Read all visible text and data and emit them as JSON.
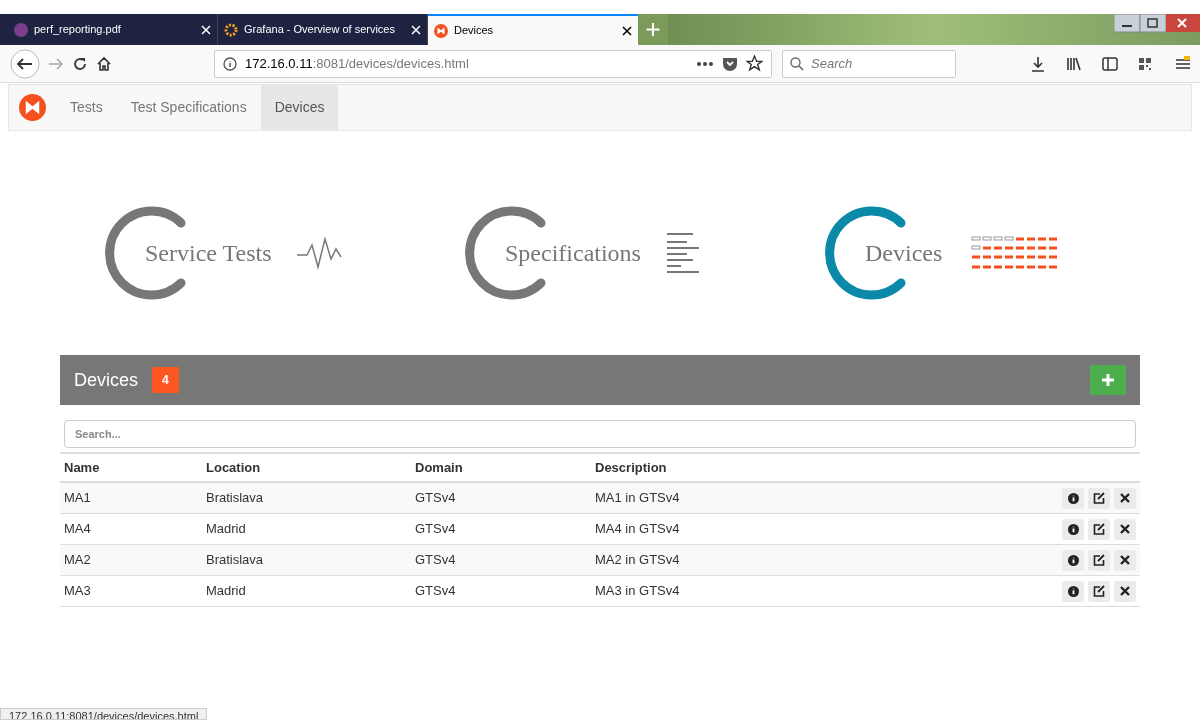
{
  "browser": {
    "tabs": [
      {
        "title": "perf_reporting.pdf",
        "kind": "pdf",
        "selected": false
      },
      {
        "title": "Grafana - Overview of services",
        "kind": "grafana",
        "selected": false
      },
      {
        "title": "Devices",
        "kind": "app",
        "selected": true
      }
    ],
    "url_host": "172.16.0.11",
    "url_rest": ":8081/devices/devices.html",
    "search": {
      "placeholder": "Search"
    }
  },
  "navbar": {
    "items": [
      {
        "label": "Tests",
        "selected": false
      },
      {
        "label": "Test Specifications",
        "selected": false
      },
      {
        "label": "Devices",
        "selected": true
      }
    ]
  },
  "hero": [
    {
      "label": "Service Tests",
      "kind": "pulse",
      "selected": false
    },
    {
      "label": "Specifications",
      "kind": "lines",
      "selected": false
    },
    {
      "label": "Devices",
      "kind": "grid",
      "selected": true
    }
  ],
  "panel": {
    "title": "Devices",
    "count": "4",
    "search": {
      "placeholder": "Search..."
    },
    "columns": [
      "Name",
      "Location",
      "Domain",
      "Description"
    ],
    "rows": [
      [
        "MA1",
        "Bratislava",
        "GTSv4",
        "MA1 in GTSv4"
      ],
      [
        "MA4",
        "Madrid",
        "GTSv4",
        "MA4 in GTSv4"
      ],
      [
        "MA2",
        "Bratislava",
        "GTSv4",
        "MA2 in GTSv4"
      ],
      [
        "MA3",
        "Madrid",
        "GTSv4",
        "MA3 in GTSv4"
      ]
    ]
  },
  "status_bar": "172.16.0.11:8081/devices/devices.html"
}
